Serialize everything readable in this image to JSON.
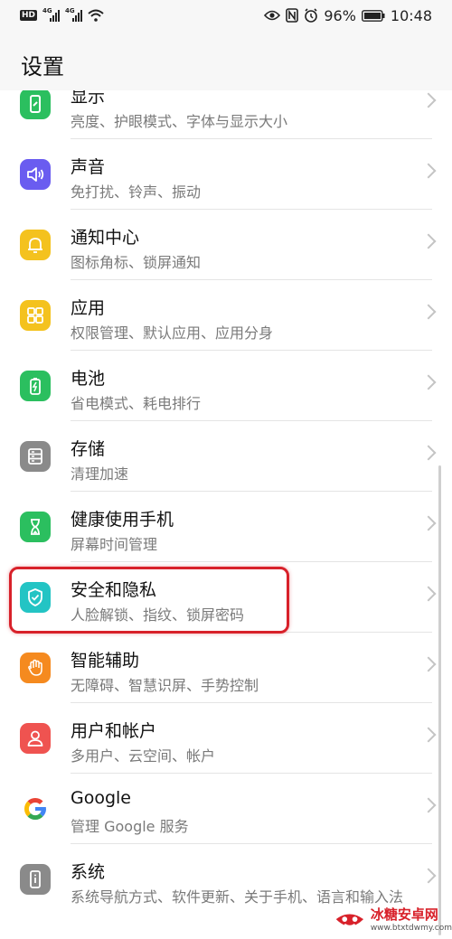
{
  "status": {
    "left_badge": "HD",
    "sim1": "4G",
    "sim2": "4G",
    "battery": "96%",
    "time": "10:48"
  },
  "header": {
    "title": "设置"
  },
  "settings": [
    {
      "label": "显示",
      "sub": "亮度、护眼模式、字体与显示大小",
      "color": "#2bbf5f",
      "icon": "phone-display-icon"
    },
    {
      "label": "声音",
      "sub": "免打扰、铃声、振动",
      "color": "#6a5cf0",
      "icon": "speaker-icon"
    },
    {
      "label": "通知中心",
      "sub": "图标角标、锁屏通知",
      "color": "#f4c21e",
      "icon": "bell-icon"
    },
    {
      "label": "应用",
      "sub": "权限管理、默认应用、应用分身",
      "color": "#f4c21e",
      "icon": "apps-grid-icon"
    },
    {
      "label": "电池",
      "sub": "省电模式、耗电排行",
      "color": "#2bbf5f",
      "icon": "battery-icon"
    },
    {
      "label": "存储",
      "sub": "清理加速",
      "color": "#8a8a8a",
      "icon": "storage-icon"
    },
    {
      "label": "健康使用手机",
      "sub": "屏幕时间管理",
      "color": "#2bbf5f",
      "icon": "hourglass-icon"
    },
    {
      "label": "安全和隐私",
      "sub": "人脸解锁、指纹、锁屏密码",
      "color": "#23c4c4",
      "icon": "shield-icon"
    },
    {
      "label": "智能辅助",
      "sub": "无障碍、智慧识屏、手势控制",
      "color": "#f58a1f",
      "icon": "hand-icon"
    },
    {
      "label": "用户和帐户",
      "sub": "多用户、云空间、帐户",
      "color": "#ef5350",
      "icon": "user-icon"
    },
    {
      "label": "Google",
      "sub": "管理 Google 服务",
      "color": "#ffffff",
      "icon": "google-icon"
    },
    {
      "label": "系统",
      "sub": "系统导航方式、软件更新、关于手机、语言和输入法",
      "color": "#8a8a8a",
      "icon": "system-icon"
    }
  ],
  "watermark": {
    "title": "冰糖安卓网",
    "url": "www.btxtdwmy.com"
  }
}
